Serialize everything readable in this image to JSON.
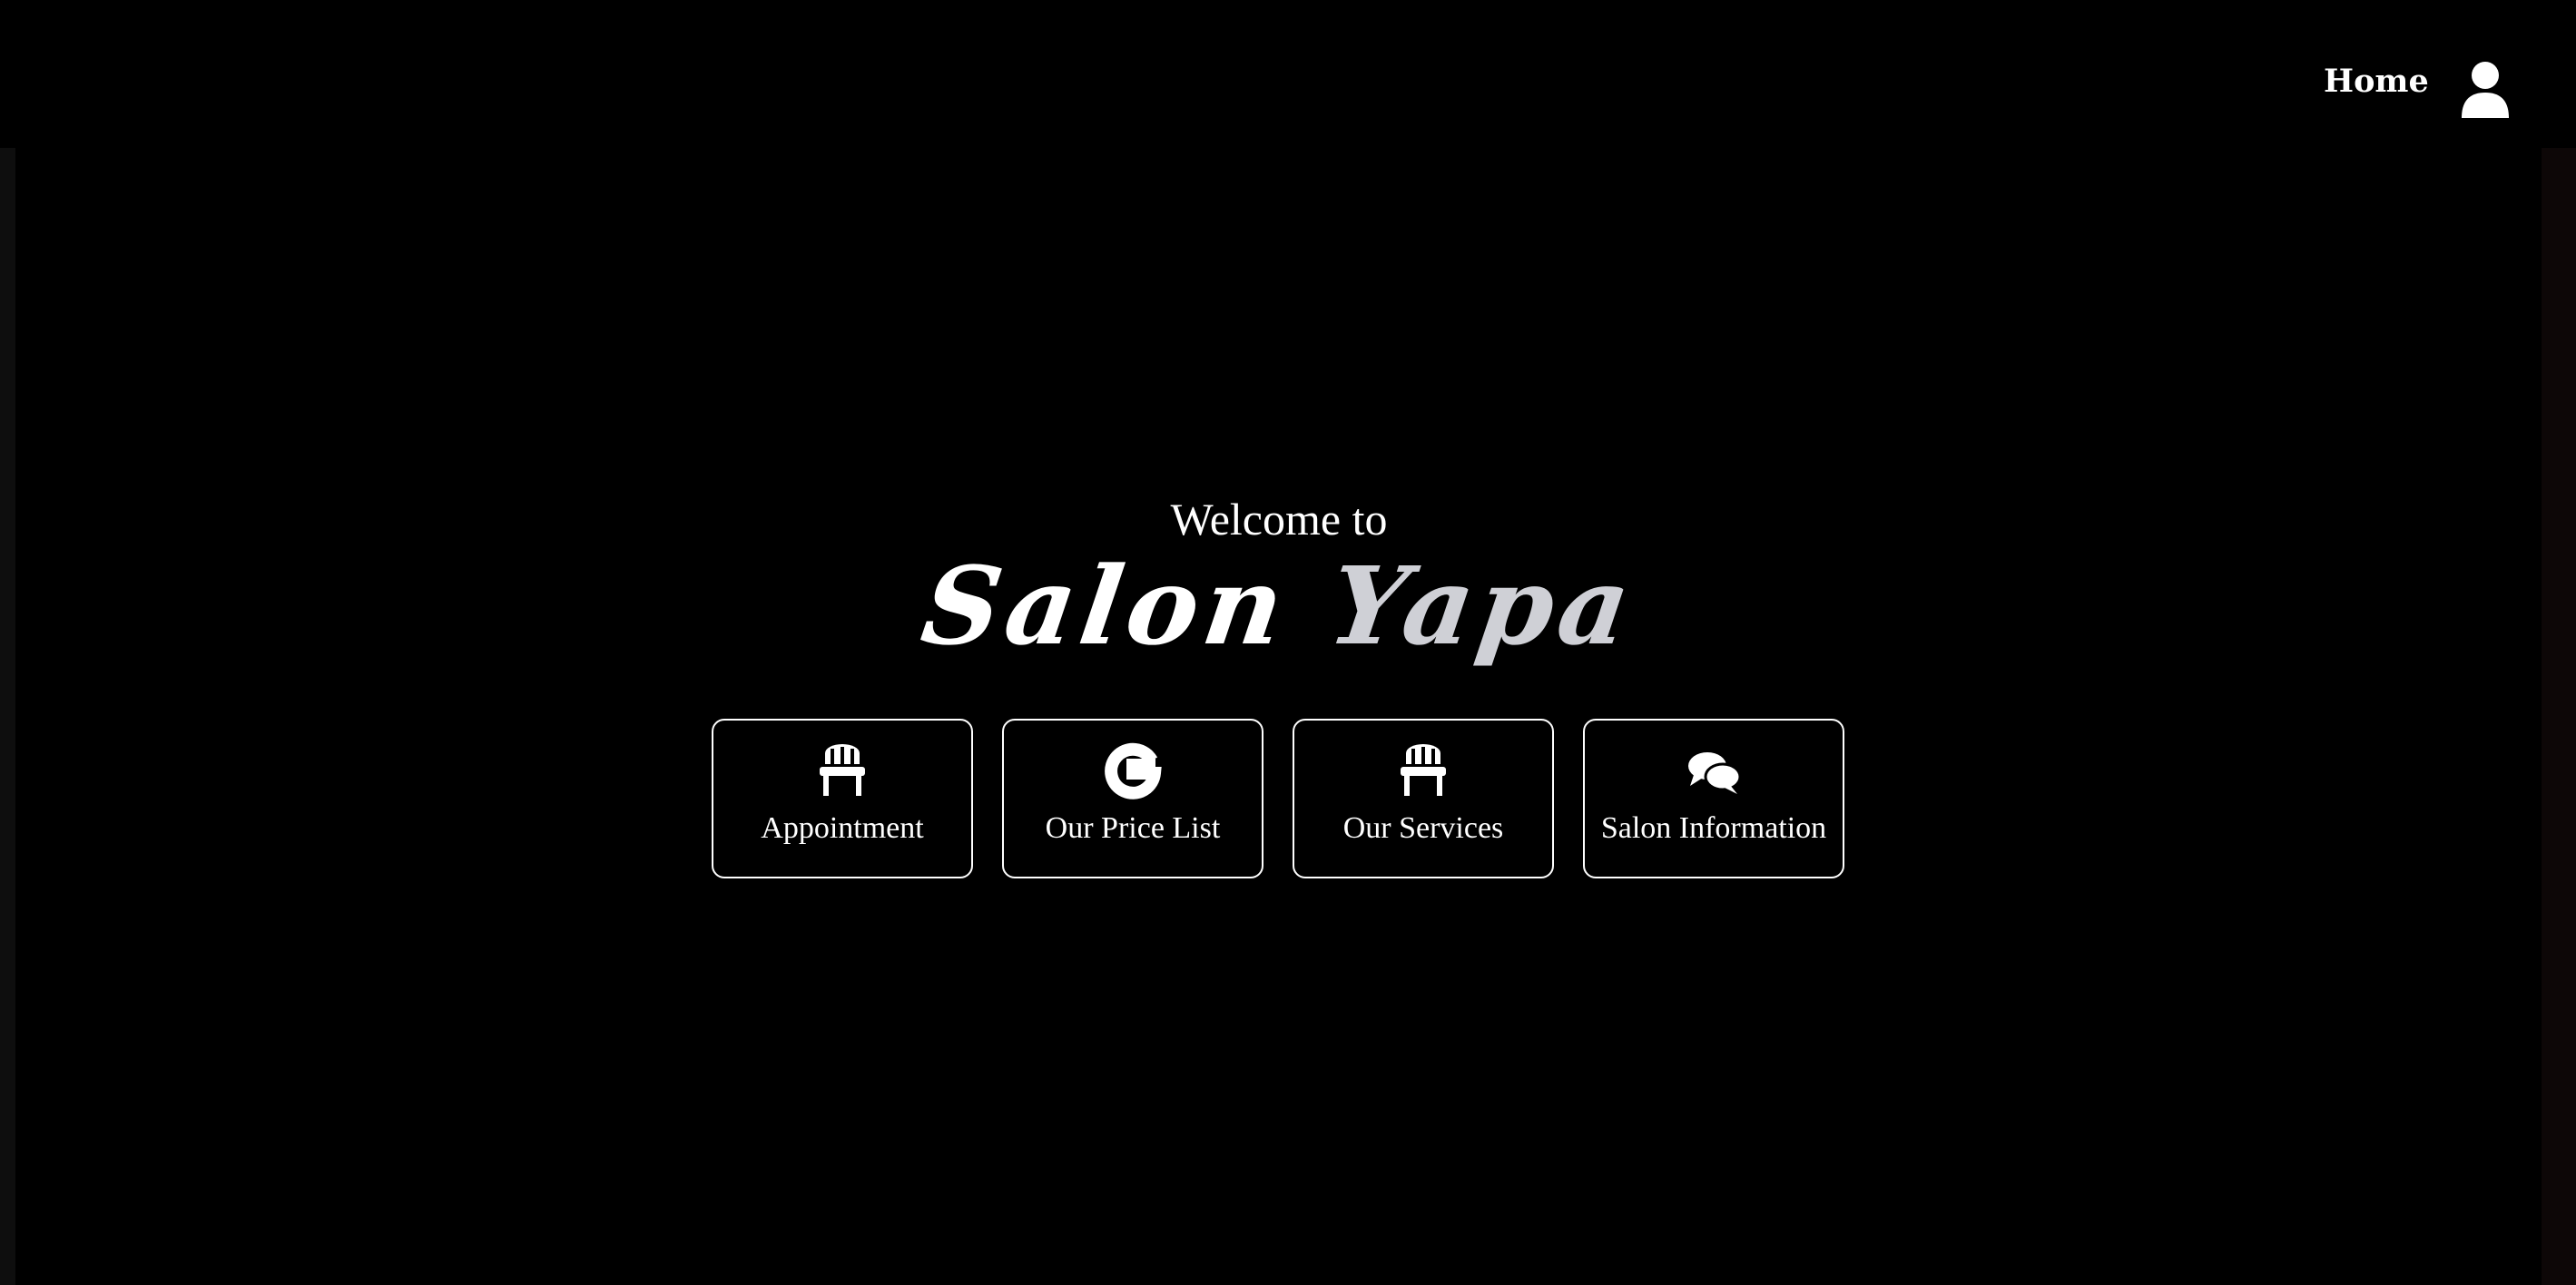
{
  "nav": {
    "home_label": "Home",
    "user_icon": "user-icon"
  },
  "hero": {
    "welcome": "Welcome to",
    "brand_word1": "Salon",
    "brand_word2": "Yapa"
  },
  "cards": [
    {
      "label": "Appointment",
      "icon": "chair-icon"
    },
    {
      "label": "Our Price List",
      "icon": "google-icon"
    },
    {
      "label": "Our Services",
      "icon": "chair-icon"
    },
    {
      "label": "Salon Information",
      "icon": "chat-bubbles-icon"
    }
  ],
  "colors": {
    "background": "#000000",
    "text": "#ffffff",
    "brand_accent": "#cfd0d6"
  }
}
